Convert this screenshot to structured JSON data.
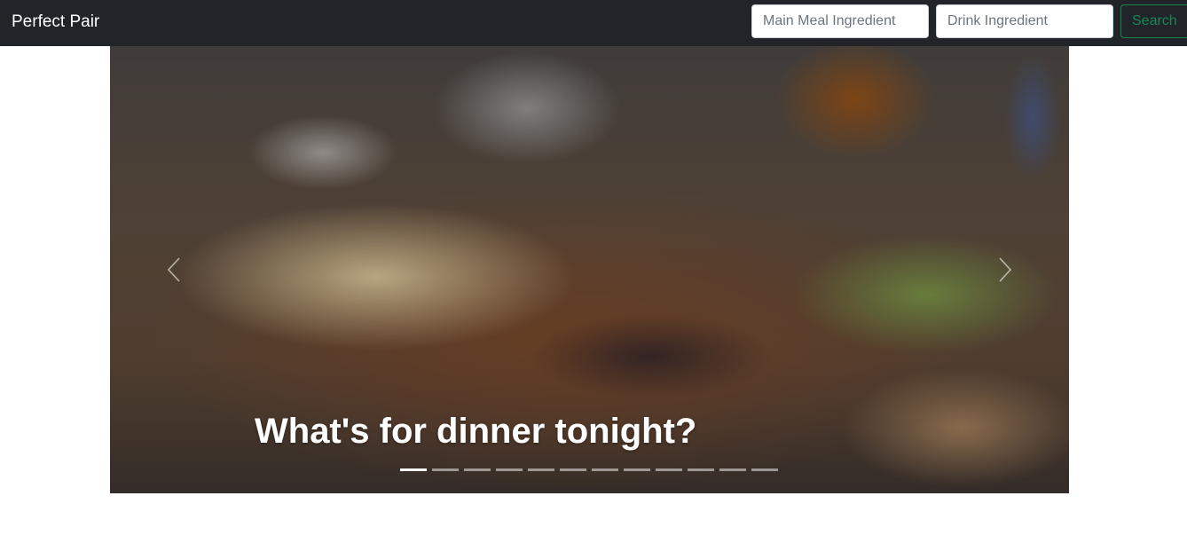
{
  "navbar": {
    "brand": "Perfect Pair",
    "meal_placeholder": "Main Meal Ingredient",
    "drink_placeholder": "Drink Ingredient",
    "search_label": "Search"
  },
  "carousel": {
    "caption": "What's for dinner tonight?",
    "indicator_count": 12,
    "active_index": 0,
    "prev_icon": "chevron-left-icon",
    "next_icon": "chevron-right-icon"
  },
  "colors": {
    "navbar_bg": "#212529",
    "search_button": "#198754"
  }
}
